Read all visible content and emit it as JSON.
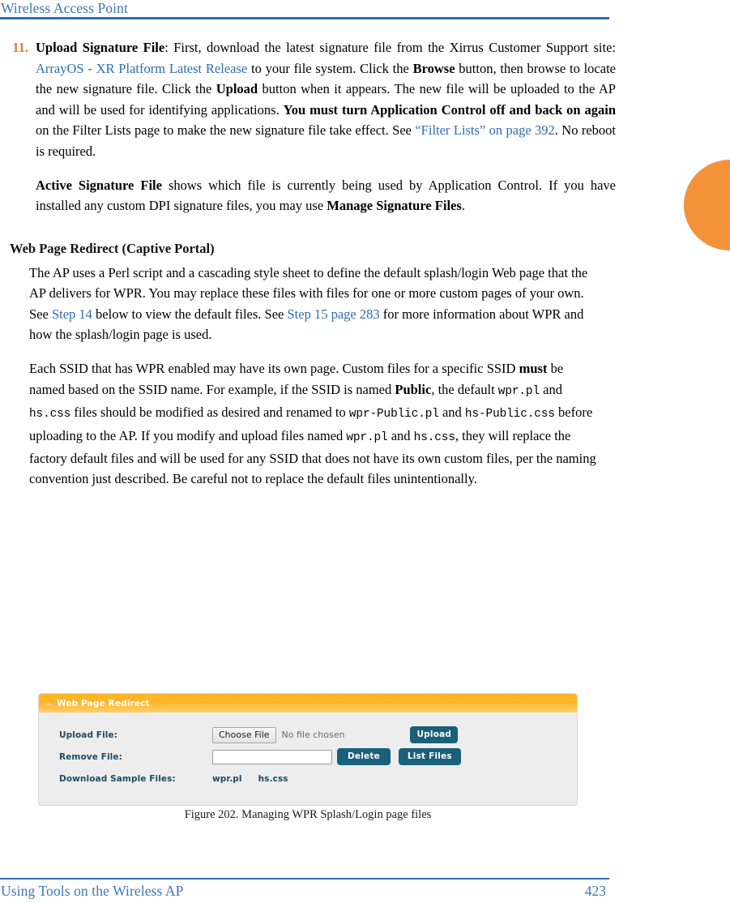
{
  "header": {
    "running_title": "Wireless Access Point"
  },
  "footer": {
    "running_title": "Using Tools on the Wireless AP",
    "page_number": "423"
  },
  "edge_tab": {
    "color": "#f39238"
  },
  "step_11": {
    "number": "11.",
    "term": "Upload Signature File",
    "t1": ": First, download the latest signature file from the Xirrus Customer Support site: ",
    "link1": "ArrayOS - XR Platform Latest Release",
    "t2": " to your file system. Click the ",
    "bold_browse": "Browse",
    "t3": " button, then browse to locate the new signature file. Click the ",
    "bold_upload": "Upload",
    "t4": " button when it appears. The new file will be uploaded to the AP and will be used for identifying applications. ",
    "bold_must": "You must turn Application Control off and back on again",
    "t5": " on the Filter Lists page to make the new signature file take effect. See ",
    "link2": "“Filter Lists” on page 392",
    "t6": ". No reboot is required.",
    "p2_term": "Active Signature File",
    "p2_t1": " shows which file is currently being used by Application Control. If you have installed any custom DPI signature files, you may use ",
    "p2_bold": "Manage Signature Files",
    "p2_t2": "."
  },
  "section": {
    "heading": "Web Page Redirect (Captive Portal)",
    "para1_a": "The AP uses a Perl script and a cascading style sheet to define the default splash/login Web page that the AP delivers for WPR. You may replace these files with files for one or more custom pages of your own. See ",
    "para1_link1": "Step 14",
    "para1_b": " below to view the default files. See ",
    "para1_link2": "Step 15 page 283",
    "para1_c": " for more information about WPR and how the splash/login page is used.",
    "para2_a": "Each SSID that has WPR enabled may have its own page. Custom files for a specific SSID ",
    "para2_bold1": "must",
    "para2_b": " be named based on the SSID name. For example, if the SSID is named ",
    "para2_bold2": "Public",
    "para2_c": ", the default ",
    "para2_mono1": "wpr.pl",
    "para2_d": " and ",
    "para2_mono2": "hs.css",
    "para2_e": " files should be modified as desired and renamed to ",
    "para2_mono3": "wpr-Public.pl",
    "para2_f": " and ",
    "para2_mono4": "hs-Public.css",
    "para2_g": " before uploading to the AP. If you modify and upload files named ",
    "para2_mono5": "wpr.pl",
    "para2_h": " and ",
    "para2_mono6": "hs.css",
    "para2_i": ", they will replace the factory default files and will be used for any SSID that does not have its own custom files, per the naming convention just described. Be careful not to replace the default files unintentionally."
  },
  "ui_panel": {
    "title": "Web Page Redirect",
    "header_color": "#fdb62a",
    "button_color": "#196079",
    "label_color": "#1d4a63",
    "rows": {
      "upload_file": {
        "label": "Upload File:",
        "choose_button": "Choose File",
        "no_file_text": "No file chosen",
        "upload_button": "Upload"
      },
      "remove_file": {
        "label": "Remove File:",
        "input_value": "",
        "input_placeholder": "",
        "delete_button": "Delete",
        "list_files_button": "List Files"
      },
      "download_sample": {
        "label": "Download Sample Files:",
        "link1": "wpr.pl",
        "link2": "hs.css"
      }
    }
  },
  "figure": {
    "caption": "Figure 202. Managing WPR Splash/Login page files"
  }
}
